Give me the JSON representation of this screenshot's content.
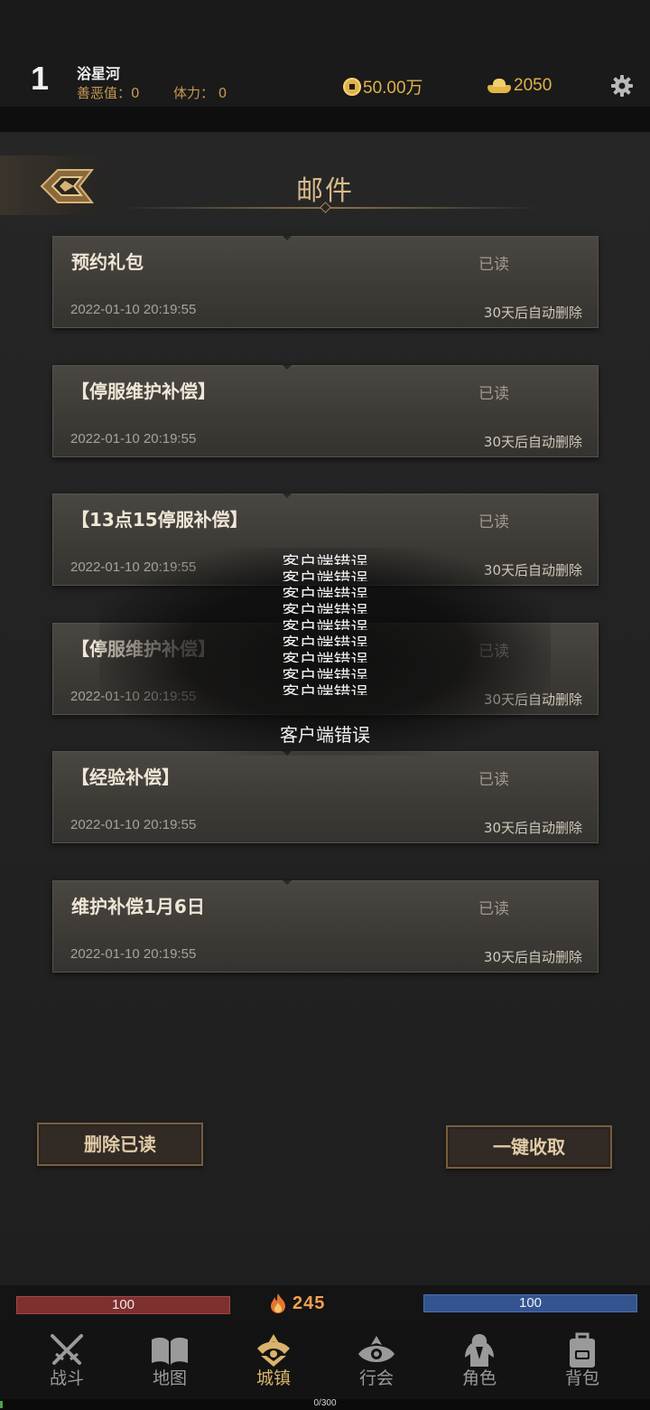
{
  "header": {
    "level": "1",
    "player_name": "浴星河",
    "karma_label": "善恶值：0",
    "stamina_label": "体力：  0",
    "coins": "50.00万",
    "gold": "2050"
  },
  "mail_panel": {
    "title": "邮件",
    "items": [
      {
        "title": "预约礼包",
        "status": "已读",
        "date": "2022-01-10 20:19:55",
        "expire": "30天后自动删除"
      },
      {
        "title": "【停服维护补偿】",
        "status": "已读",
        "date": "2022-01-10 20:19:55",
        "expire": "30天后自动删除"
      },
      {
        "title": "【13点15停服补偿】",
        "status": "已读",
        "date": "2022-01-10 20:19:55",
        "expire": "30天后自动删除"
      },
      {
        "title": "【停服维护补偿】",
        "status": "已读",
        "date": "2022-01-10 20:19:55",
        "expire": "30天后自动删除"
      },
      {
        "title": "【经验补偿】",
        "status": "已读",
        "date": "2022-01-10 20:19:55",
        "expire": "30天后自动删除"
      },
      {
        "title": "维护补偿1月6日",
        "status": "已读",
        "date": "2022-01-10 20:19:55",
        "expire": "30天后自动删除"
      }
    ],
    "delete_read_label": "删除已读",
    "collect_all_label": "一键收取"
  },
  "error_overlay": {
    "message": "客户端错误"
  },
  "stats": {
    "hp": "100",
    "mp": "100",
    "power": "245"
  },
  "nav": {
    "items": [
      {
        "label": "战斗",
        "icon": "crossed-swords-icon"
      },
      {
        "label": "地图",
        "icon": "map-book-icon"
      },
      {
        "label": "城镇",
        "icon": "town-crest-icon",
        "active": true
      },
      {
        "label": "行会",
        "icon": "guild-eye-icon"
      },
      {
        "label": "角色",
        "icon": "character-icon"
      },
      {
        "label": "背包",
        "icon": "backpack-icon"
      }
    ]
  },
  "exp": {
    "label": "0/300",
    "progress": 0.0
  },
  "colors": {
    "accent_gold": "#d9b36c",
    "hp_red": "#7e2f2f",
    "mp_blue": "#33548f"
  }
}
